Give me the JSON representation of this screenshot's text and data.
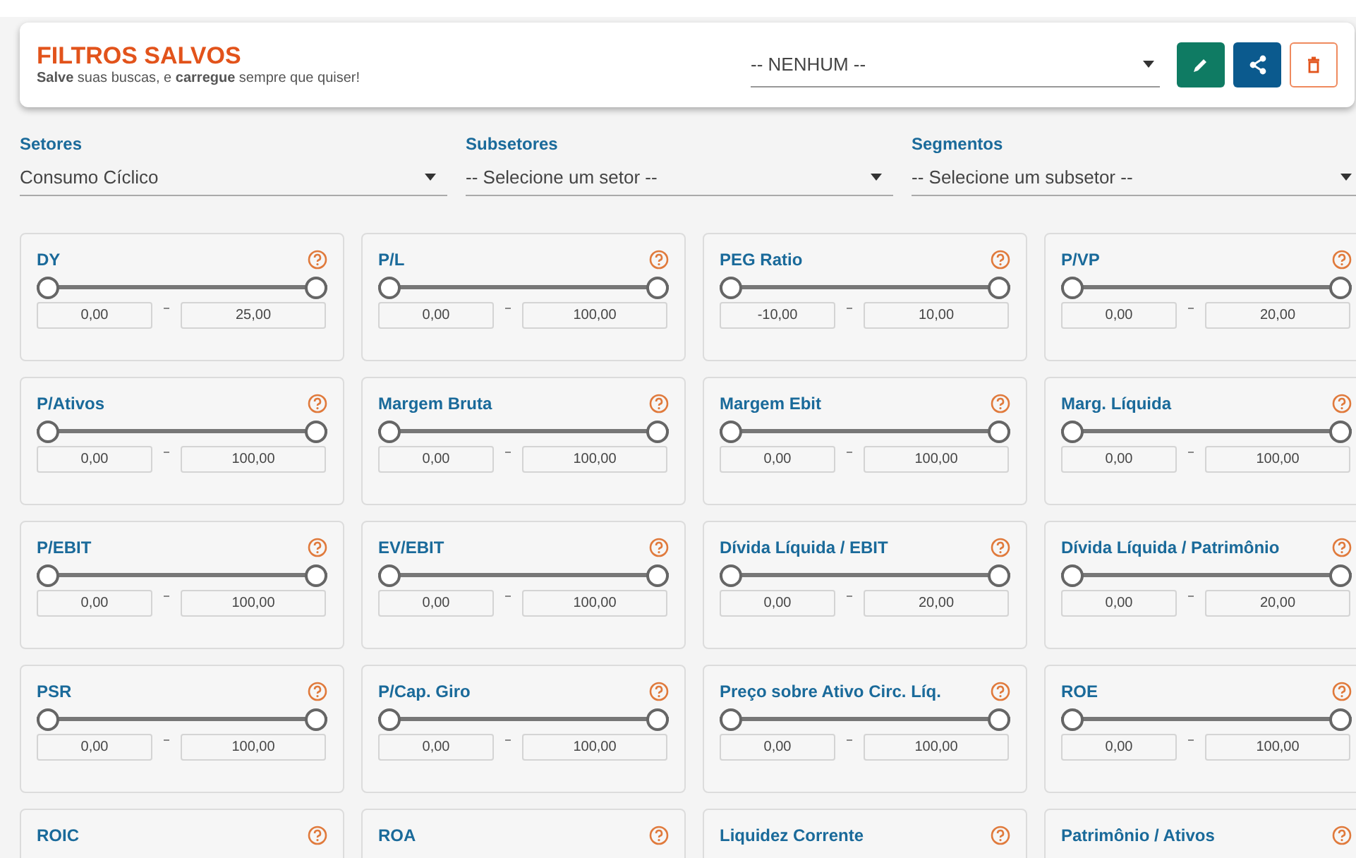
{
  "saved_filters": {
    "title": "FILTROS SALVOS",
    "subtitle": "**Salve** suas buscas, e **carregue** sempre que quiser!",
    "selection": "-- NENHUM --"
  },
  "selectors": [
    {
      "label": "Setores",
      "value": "Consumo Cíclico"
    },
    {
      "label": "Subsetores",
      "value": "-- Selecione um setor --"
    },
    {
      "label": "Segmentos",
      "value": "-- Selecione um subsetor --"
    }
  ],
  "indicators": [
    {
      "label": "DY",
      "level": 1,
      "min": "0,00",
      "max": "25,00"
    },
    {
      "label": "P/L",
      "level": 1,
      "min": "0,00",
      "max": "100,00"
    },
    {
      "label": "PEG Ratio",
      "level": 1,
      "min": "-10,00",
      "max": "10,00"
    },
    {
      "label": "P/VP",
      "level": 1,
      "min": "0,00",
      "max": "20,00"
    },
    {
      "label": "P/Ativos",
      "level": 1,
      "min": "0,00",
      "max": "100,00"
    },
    {
      "label": "Margem Bruta",
      "level": 1,
      "min": "0,00",
      "max": "100,00"
    },
    {
      "label": "Margem Ebit",
      "level": 1,
      "min": "0,00",
      "max": "100,00"
    },
    {
      "label": "Marg. Líquida",
      "level": 1,
      "min": "0,00",
      "max": "100,00"
    },
    {
      "label": "P/EBIT",
      "level": 1,
      "min": "0,00",
      "max": "100,00"
    },
    {
      "label": "EV/EBIT",
      "level": 1,
      "min": "0,00",
      "max": "100,00"
    },
    {
      "label": "Dívida Líquida / EBIT",
      "level": 1,
      "min": "0,00",
      "max": "20,00"
    },
    {
      "label": "Dívida Líquida / Patrimônio",
      "level": 1,
      "min": "0,00",
      "max": "20,00"
    },
    {
      "label": "PSR",
      "level": 1,
      "min": "0,00",
      "max": "100,00"
    },
    {
      "label": "P/Cap. Giro",
      "level": 1,
      "min": "0,00",
      "max": "100,00"
    },
    {
      "label": "Preço sobre Ativo Circ. Líq.",
      "level": 1,
      "min": "0,00",
      "max": "100,00"
    },
    {
      "label": "ROE",
      "level": 1,
      "min": "0,00",
      "max": "100,00"
    },
    {
      "label": "ROIC"
    },
    {
      "label": "ROA"
    },
    {
      "label": "Liquidez Corrente"
    },
    {
      "label": "Patrimônio / Ativos"
    }
  ]
}
